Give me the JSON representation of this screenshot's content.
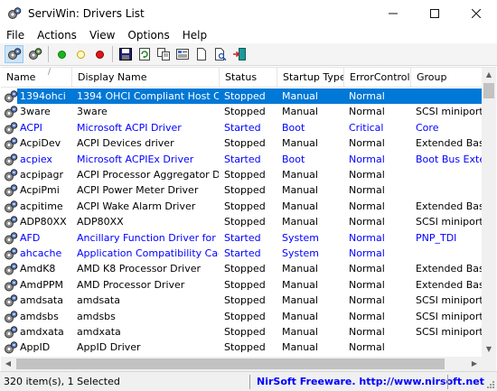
{
  "window": {
    "title": "ServiWin: Drivers List"
  },
  "menu": [
    "File",
    "Actions",
    "View",
    "Options",
    "Help"
  ],
  "columns": [
    "Name",
    "Display Name",
    "Status",
    "Startup Type",
    "ErrorControl",
    "Group"
  ],
  "rows": [
    {
      "name": "1394ohci",
      "display": "1394 OHCI Compliant Host C...",
      "status": "Stopped",
      "startup": "Manual",
      "error": "Normal",
      "group": "",
      "selected": true,
      "blue": false
    },
    {
      "name": "3ware",
      "display": "3ware",
      "status": "Stopped",
      "startup": "Manual",
      "error": "Normal",
      "group": "SCSI miniport",
      "selected": false,
      "blue": false
    },
    {
      "name": "ACPI",
      "display": "Microsoft ACPI Driver",
      "status": "Started",
      "startup": "Boot",
      "error": "Critical",
      "group": "Core",
      "selected": false,
      "blue": true
    },
    {
      "name": "AcpiDev",
      "display": "ACPI Devices driver",
      "status": "Stopped",
      "startup": "Manual",
      "error": "Normal",
      "group": "Extended Base",
      "selected": false,
      "blue": false
    },
    {
      "name": "acpiex",
      "display": "Microsoft ACPIEx Driver",
      "status": "Started",
      "startup": "Boot",
      "error": "Normal",
      "group": "Boot Bus Exten",
      "selected": false,
      "blue": true
    },
    {
      "name": "acpipagr",
      "display": "ACPI Processor Aggregator Dr...",
      "status": "Stopped",
      "startup": "Manual",
      "error": "Normal",
      "group": "",
      "selected": false,
      "blue": false
    },
    {
      "name": "AcpiPmi",
      "display": "ACPI Power Meter Driver",
      "status": "Stopped",
      "startup": "Manual",
      "error": "Normal",
      "group": "",
      "selected": false,
      "blue": false
    },
    {
      "name": "acpitime",
      "display": "ACPI Wake Alarm Driver",
      "status": "Stopped",
      "startup": "Manual",
      "error": "Normal",
      "group": "Extended Base",
      "selected": false,
      "blue": false
    },
    {
      "name": "ADP80XX",
      "display": "ADP80XX",
      "status": "Stopped",
      "startup": "Manual",
      "error": "Normal",
      "group": "SCSI miniport",
      "selected": false,
      "blue": false
    },
    {
      "name": "AFD",
      "display": "Ancillary Function Driver for ...",
      "status": "Started",
      "startup": "System",
      "error": "Normal",
      "group": "PNP_TDI",
      "selected": false,
      "blue": true
    },
    {
      "name": "ahcache",
      "display": "Application Compatibility Cac...",
      "status": "Started",
      "startup": "System",
      "error": "Normal",
      "group": "",
      "selected": false,
      "blue": true
    },
    {
      "name": "AmdK8",
      "display": "AMD K8 Processor Driver",
      "status": "Stopped",
      "startup": "Manual",
      "error": "Normal",
      "group": "Extended Base",
      "selected": false,
      "blue": false
    },
    {
      "name": "AmdPPM",
      "display": "AMD Processor Driver",
      "status": "Stopped",
      "startup": "Manual",
      "error": "Normal",
      "group": "Extended Base",
      "selected": false,
      "blue": false
    },
    {
      "name": "amdsata",
      "display": "amdsata",
      "status": "Stopped",
      "startup": "Manual",
      "error": "Normal",
      "group": "SCSI miniport",
      "selected": false,
      "blue": false
    },
    {
      "name": "amdsbs",
      "display": "amdsbs",
      "status": "Stopped",
      "startup": "Manual",
      "error": "Normal",
      "group": "SCSI miniport",
      "selected": false,
      "blue": false
    },
    {
      "name": "amdxata",
      "display": "amdxata",
      "status": "Stopped",
      "startup": "Manual",
      "error": "Normal",
      "group": "SCSI miniport",
      "selected": false,
      "blue": false
    },
    {
      "name": "AppID",
      "display": "AppID Driver",
      "status": "Stopped",
      "startup": "Manual",
      "error": "Normal",
      "group": "",
      "selected": false,
      "blue": false
    }
  ],
  "statusbar": {
    "count": "320 item(s), 1 Selected",
    "link": "NirSoft Freeware.  http://www.nirsoft.net"
  },
  "colors": {
    "selection": "#0078d7",
    "started_text": "#0000ff",
    "link": "#0000ff"
  }
}
